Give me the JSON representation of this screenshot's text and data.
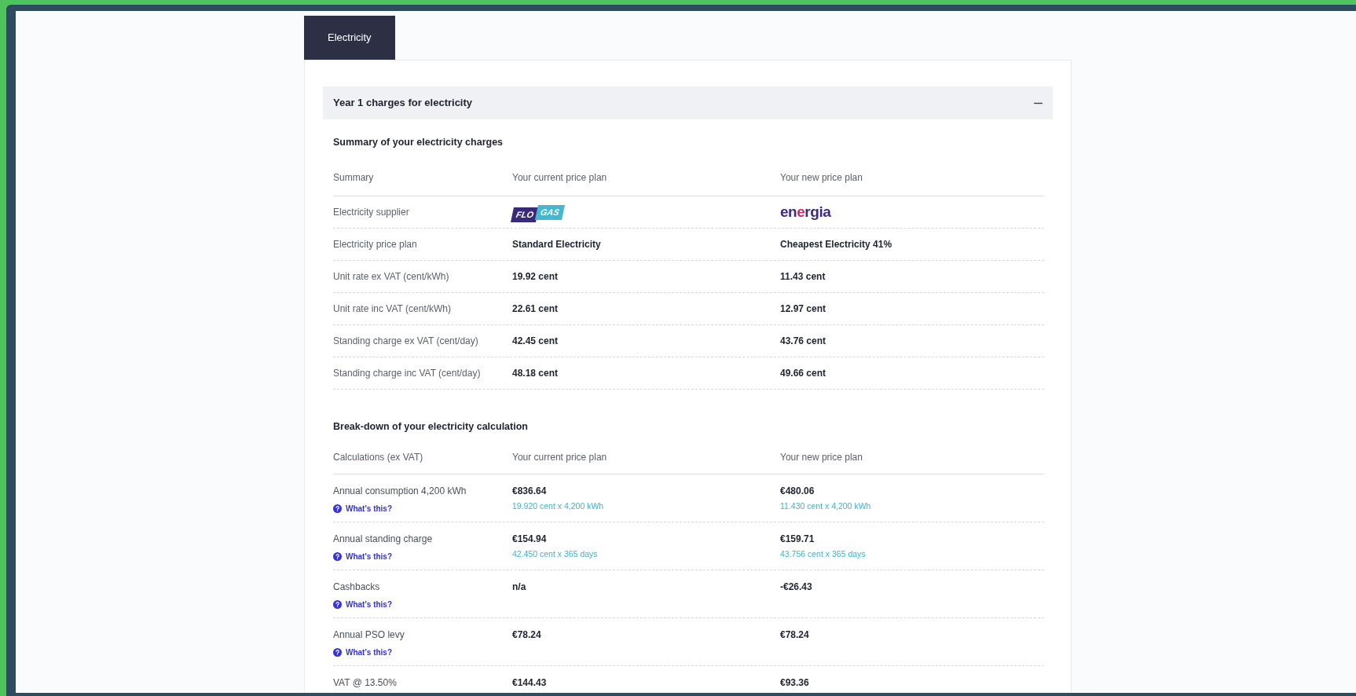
{
  "tabs": [
    {
      "label": "Electricity",
      "selected": true
    }
  ],
  "accordion": {
    "title": "Year 1 charges for electricity",
    "expanded": true
  },
  "summary": {
    "title": "Summary of your electricity charges",
    "columns": [
      "Summary",
      "Your current price plan",
      "Your new price plan"
    ],
    "rows": [
      {
        "kind": "logo",
        "label": "Electricity supplier",
        "current": [
          "FLO",
          "GAS"
        ],
        "new": [
          "en",
          "e",
          "rgia"
        ]
      },
      {
        "kind": "text",
        "label": "Electricity price plan",
        "current": "Standard Electricity",
        "new": "Cheapest Electricity 41%"
      },
      {
        "kind": "text",
        "label": "Unit rate ex VAT (cent/kWh)",
        "current": "19.92 cent",
        "new": "11.43 cent"
      },
      {
        "kind": "text",
        "label": "Unit rate inc VAT (cent/kWh)",
        "current": "22.61 cent",
        "new": "12.97 cent"
      },
      {
        "kind": "text",
        "label": "Standing charge ex VAT (cent/day)",
        "current": "42.45 cent",
        "new": "43.76 cent"
      },
      {
        "kind": "text",
        "label": "Standing charge inc VAT (cent/day)",
        "current": "48.18 cent",
        "new": "49.66 cent"
      }
    ]
  },
  "breakdown": {
    "title": "Break-down of your electricity calculation",
    "columns": [
      "Calculations (ex VAT)",
      "Your current price plan",
      "Your new price plan"
    ],
    "rows": [
      {
        "label": "Annual consumption 4,200 kWh",
        "help": "What's this?",
        "current": {
          "amount": "€836.64",
          "detail": "19.920 cent x 4,200 kWh"
        },
        "new": {
          "amount": "€480.06",
          "detail": "11.430 cent x 4,200 kWh"
        }
      },
      {
        "label": "Annual standing charge",
        "help": "What's this?",
        "current": {
          "amount": "€154.94",
          "detail": "42.450 cent x 365 days"
        },
        "new": {
          "amount": "€159.71",
          "detail": "43.756 cent x 365 days"
        }
      },
      {
        "label": "Cashbacks",
        "help": "What's this?",
        "current": {
          "amount": "n/a"
        },
        "new": {
          "amount": "-€26.43"
        }
      },
      {
        "label": "Annual PSO levy",
        "help": "What's this?",
        "current": {
          "amount": "€78.24"
        },
        "new": {
          "amount": "€78.24"
        }
      },
      {
        "label": "VAT @ 13.50%",
        "current": {
          "amount": "€144.43"
        },
        "new": {
          "amount": "€93.36"
        }
      }
    ]
  }
}
